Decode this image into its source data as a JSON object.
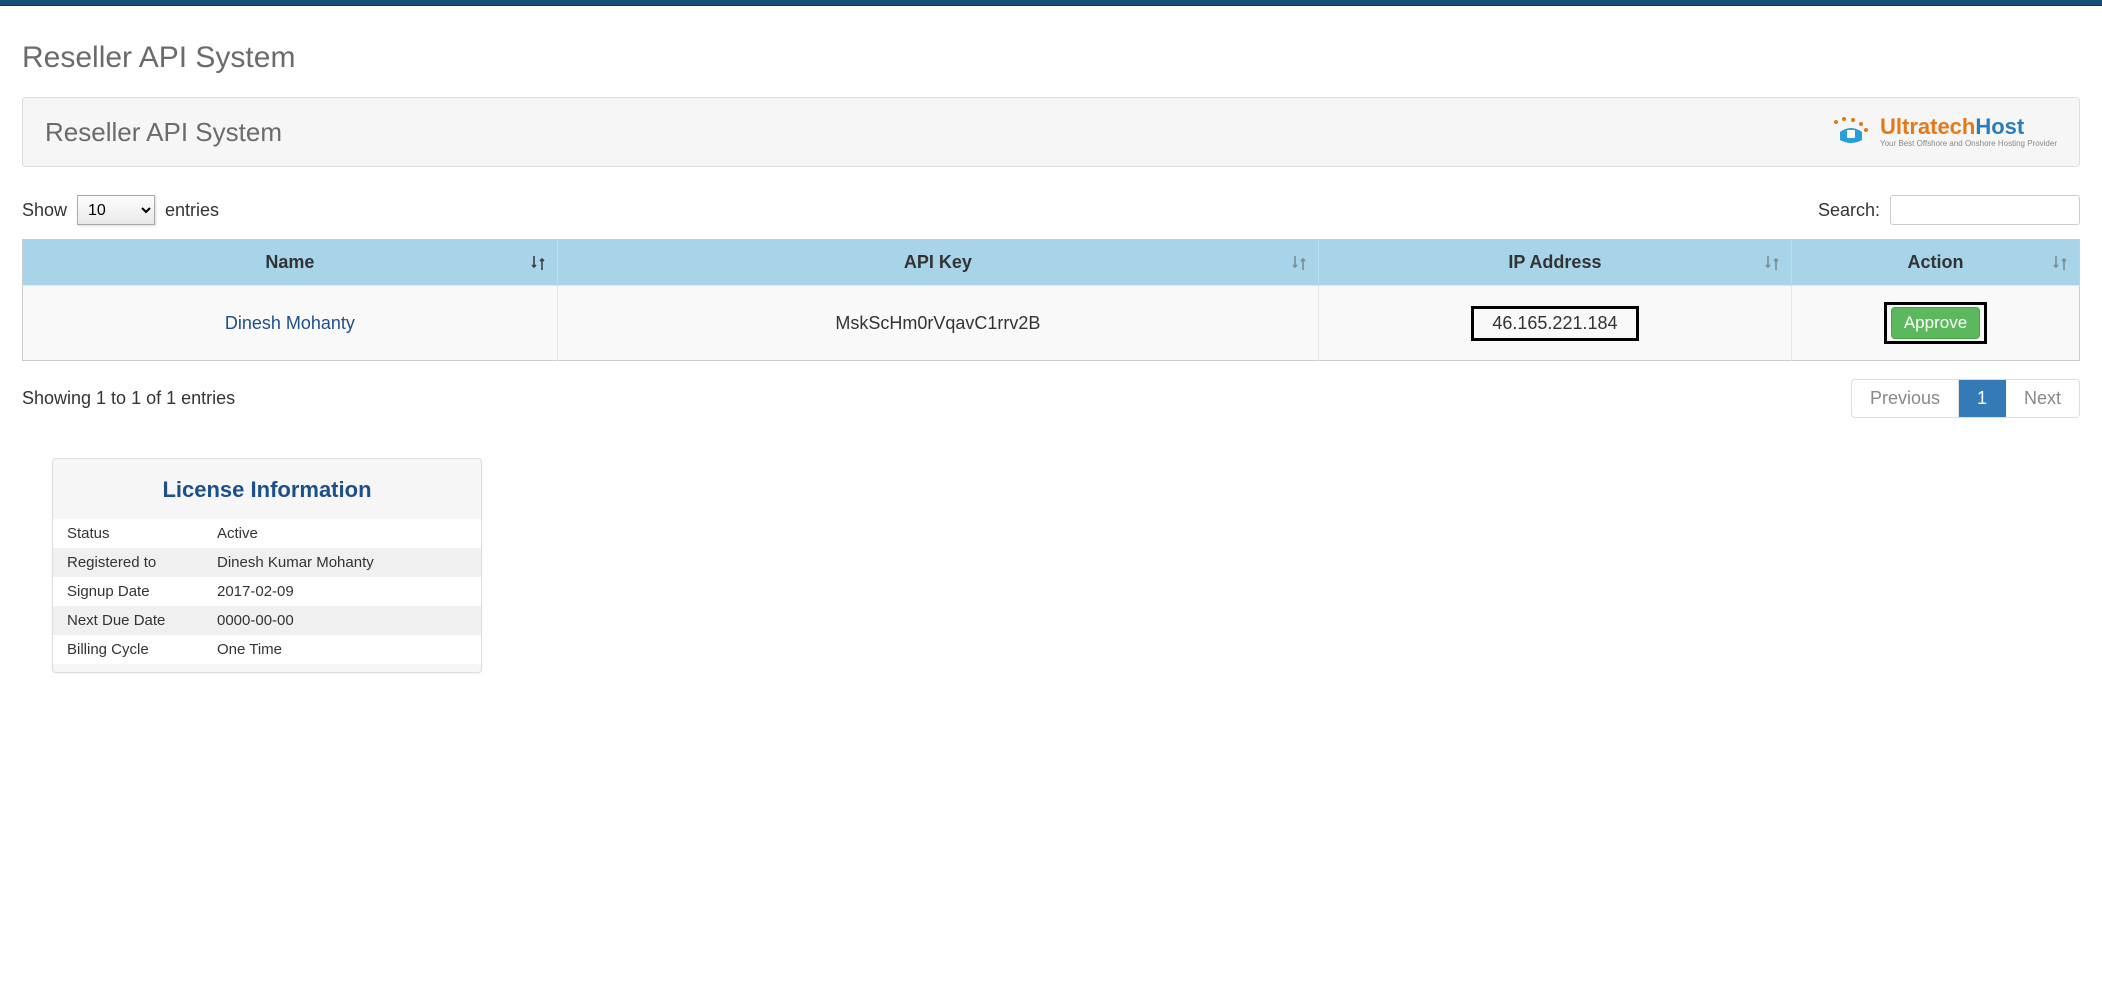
{
  "page": {
    "title": "Reseller API System"
  },
  "panel": {
    "title": "Reseller API System",
    "logo": {
      "name_part1": "Ultratech",
      "name_part2": "Host",
      "tagline": "Your Best Offshore and Onshore Hosting Provider"
    }
  },
  "table_controls": {
    "show_label_pre": "Show",
    "show_label_post": "entries",
    "page_size": "10",
    "search_label": "Search:",
    "search_value": ""
  },
  "table": {
    "headers": {
      "name": "Name",
      "api_key": "API Key",
      "ip_address": "IP Address",
      "action": "Action"
    },
    "rows": [
      {
        "name": "Dinesh Mohanty",
        "api_key": "MskScHm0rVqavC1rrv2B",
        "ip_address": "46.165.221.184",
        "action_label": "Approve"
      }
    ]
  },
  "footer": {
    "info": "Showing 1 to 1 of 1 entries",
    "prev": "Previous",
    "page": "1",
    "next": "Next"
  },
  "license": {
    "title": "License Information",
    "rows": [
      {
        "label": "Status",
        "value": "Active"
      },
      {
        "label": "Registered to",
        "value": "Dinesh Kumar Mohanty"
      },
      {
        "label": "Signup Date",
        "value": "2017-02-09"
      },
      {
        "label": "Next Due Date",
        "value": "0000-00-00"
      },
      {
        "label": "Billing Cycle",
        "value": "One Time"
      }
    ]
  }
}
